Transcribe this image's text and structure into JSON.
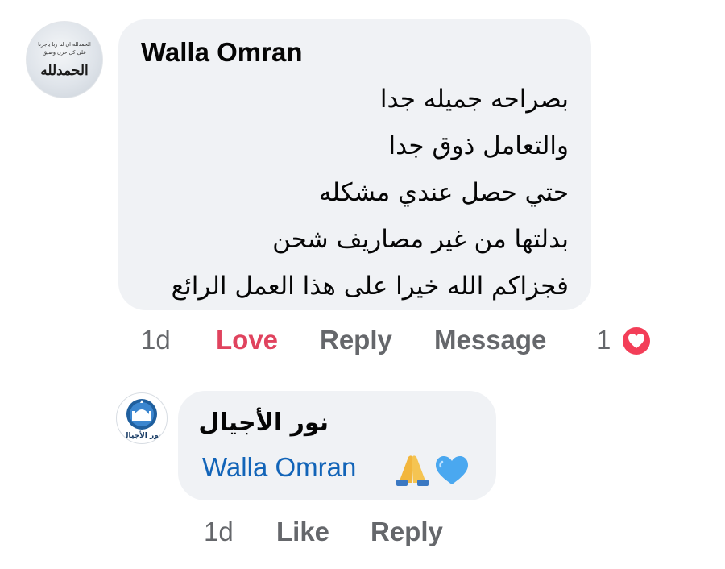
{
  "comment": {
    "author": "Walla Omran",
    "avatar_text": {
      "top_line1": "الحمدلله ان لنا ربا يأجرنا",
      "top_line2": "على كل حزن وضيق",
      "main": "الحمدلله"
    },
    "lines": [
      "بصراحه جميله جدا",
      "والتعامل ذوق جدا",
      "حتي حصل عندي مشكله",
      "بدلتها من غير مصاريف شحن",
      "فجزاكم الله خيرا على هذا العمل الرائع"
    ],
    "actions": {
      "time": "1d",
      "love": "Love",
      "reply": "Reply",
      "message": "Message"
    },
    "reaction_count": "1",
    "reaction_icon": "heart-icon",
    "love_color": "#e0435e"
  },
  "reply": {
    "author": "نور الأجيال",
    "avatar_text": "نور الأجيال",
    "mention": "Walla Omran",
    "emojis": [
      "folded-hands-icon",
      "blue-heart-icon"
    ],
    "actions": {
      "time": "1d",
      "like": "Like",
      "reply": "Reply"
    },
    "mention_color": "#1264b8"
  }
}
